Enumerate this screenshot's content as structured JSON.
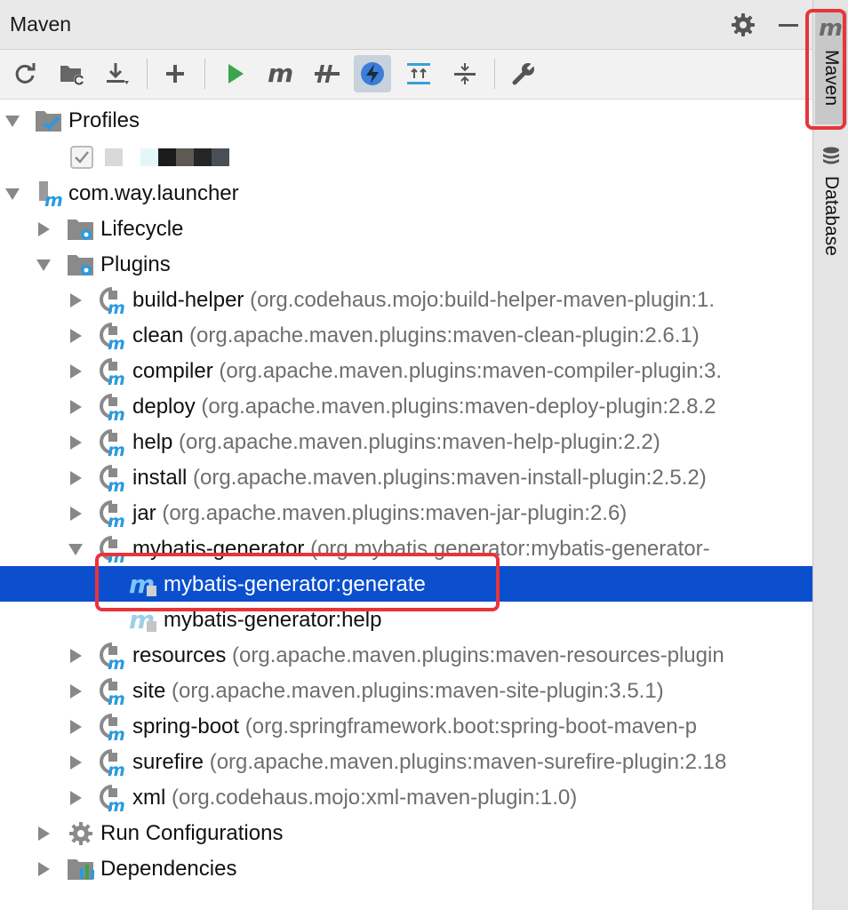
{
  "header": {
    "title": "Maven",
    "icons": [
      "gear-icon",
      "minimize-icon"
    ]
  },
  "toolbar": {
    "buttons": [
      "reload-icon",
      "folder-refresh-icon",
      "download-icon",
      "add-icon",
      "run-icon",
      "maven-m-icon",
      "toggle-offline-icon",
      "skip-tests-icon",
      "expand-all-icon",
      "collapse-all-icon",
      "settings-wrench-icon"
    ],
    "active": "skip-tests-icon"
  },
  "tree": {
    "profiles": {
      "label": "Profiles",
      "checked": true
    },
    "project": {
      "label": "com.way.launcher"
    },
    "lifecycle": {
      "label": "Lifecycle"
    },
    "plugins": {
      "label": "Plugins"
    },
    "plugin_list": [
      {
        "name": "build-helper",
        "coords": "(org.codehaus.mojo:build-helper-maven-plugin:1."
      },
      {
        "name": "clean",
        "coords": "(org.apache.maven.plugins:maven-clean-plugin:2.6.1)"
      },
      {
        "name": "compiler",
        "coords": "(org.apache.maven.plugins:maven-compiler-plugin:3."
      },
      {
        "name": "deploy",
        "coords": "(org.apache.maven.plugins:maven-deploy-plugin:2.8.2"
      },
      {
        "name": "help",
        "coords": "(org.apache.maven.plugins:maven-help-plugin:2.2)"
      },
      {
        "name": "install",
        "coords": "(org.apache.maven.plugins:maven-install-plugin:2.5.2)"
      },
      {
        "name": "jar",
        "coords": "(org.apache.maven.plugins:maven-jar-plugin:2.6)"
      },
      {
        "name": "mybatis-generator",
        "coords": "(org.mybatis.generator:mybatis-generator-"
      },
      {
        "name": "resources",
        "coords": "(org.apache.maven.plugins:maven-resources-plugin"
      },
      {
        "name": "site",
        "coords": "(org.apache.maven.plugins:maven-site-plugin:3.5.1)"
      },
      {
        "name": "spring-boot",
        "coords": "(org.springframework.boot:spring-boot-maven-p"
      },
      {
        "name": "surefire",
        "coords": "(org.apache.maven.plugins:maven-surefire-plugin:2.18"
      },
      {
        "name": "xml",
        "coords": "(org.codehaus.mojo:xml-maven-plugin:1.0)"
      }
    ],
    "goals": [
      {
        "label": "mybatis-generator:generate",
        "selected": true
      },
      {
        "label": "mybatis-generator:help",
        "selected": false
      }
    ],
    "run_configurations": {
      "label": "Run Configurations"
    },
    "dependencies": {
      "label": "Dependencies"
    }
  },
  "side_panel": {
    "maven": {
      "label": "Maven",
      "active": true
    },
    "database": {
      "label": "Database"
    }
  },
  "colors": {
    "selection": "#0b4fce",
    "highlight": "#e8343a",
    "maven_blue": "#2a9be0"
  }
}
